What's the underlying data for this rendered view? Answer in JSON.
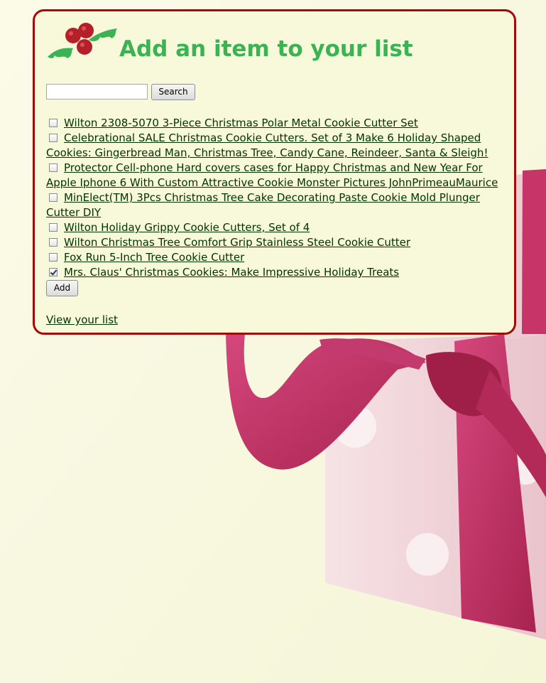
{
  "header": {
    "title": "Add an item to your list"
  },
  "search": {
    "value": "",
    "placeholder": "",
    "button_label": "Search"
  },
  "items": [
    {
      "label": "Wilton 2308-5070 3-Piece Christmas Polar Metal Cookie Cutter Set",
      "checked": false
    },
    {
      "label": "Celebrational SALE Christmas Cookie Cutters. Set of 3 Make 6 Holiday Shaped Cookies: Gingerbread Man, Christmas Tree, Candy Cane, Reindeer, Santa & Sleigh!",
      "checked": false
    },
    {
      "label": "Protector Cell-phone Hard covers cases for Happy Christmas and New Year For Apple Iphone 6 With Custom Attractive Cookie Monster Pictures JohnPrimeauMaurice",
      "checked": false
    },
    {
      "label": "MinElect(TM) 3Pcs Christmas Tree Cake Decorating Paste Cookie Mold Plunger Cutter DIY",
      "checked": false
    },
    {
      "label": "Wilton Holiday Grippy Cookie Cutters, Set of 4",
      "checked": false
    },
    {
      "label": "Wilton Christmas Tree Comfort Grip Stainless Steel Cookie Cutter",
      "checked": false
    },
    {
      "label": "Fox Run 5-Inch Tree Cookie Cutter",
      "checked": false
    },
    {
      "label": "Mrs. Claus' Christmas Cookies: Make Impressive Holiday Treats",
      "checked": true
    }
  ],
  "add_button_label": "Add",
  "view_list_link": "View your list",
  "colors": {
    "panel_border": "#a30b0b",
    "panel_background": "#f8f8da",
    "title_green": "#3bb352",
    "link_color": "#003300",
    "ribbon": "#c23a6e",
    "box": "#f1d6dc"
  },
  "icons": {
    "logo": "holly-icon",
    "checkbox": "checkbox-icon"
  }
}
